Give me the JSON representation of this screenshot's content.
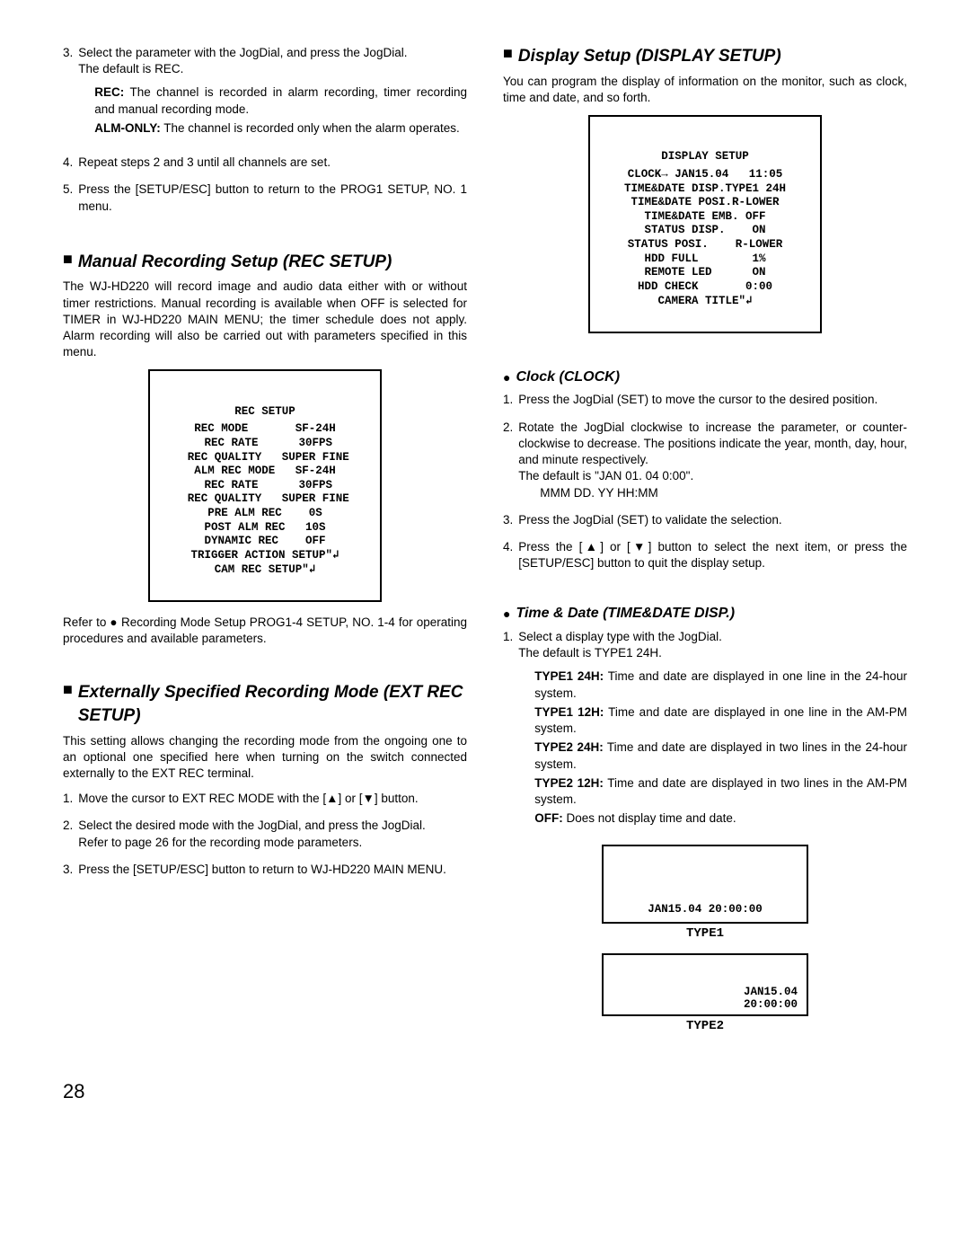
{
  "left": {
    "step3": {
      "num": "3.",
      "text": "Select the parameter with the JogDial, and press the JogDial.",
      "sub": "The default is REC.",
      "def_rec_label": "REC:",
      "def_rec_text": " The channel is recorded in alarm recording, timer recording and manual recording mode.",
      "def_alm_label": "ALM-ONLY:",
      "def_alm_text": " The channel is recorded only when the alarm operates."
    },
    "step4": {
      "num": "4.",
      "text": "Repeat steps 2 and 3 until all channels are set."
    },
    "step5": {
      "num": "5.",
      "text": "Press the [SETUP/ESC] button to return to the PROG1 SETUP, NO. 1 menu."
    },
    "rec_heading": "Manual Recording Setup (REC SETUP)",
    "rec_para": "The WJ-HD220 will record image and audio data either with or without timer restrictions. Manual recording is available when OFF is selected for TIMER in WJ-HD220 MAIN MENU; the timer schedule does not apply. Alarm recording will also be carried out with parameters specified in this menu.",
    "rec_screen_title": "REC SETUP",
    "rec_screen_body": "REC MODE       SF-24H\n REC RATE      30FPS\n REC QUALITY   SUPER FINE\nALM REC MODE   SF-24H\n REC RATE      30FPS\n REC QUALITY   SUPER FINE\nPRE ALM REC    0S\nPOST ALM REC   10S\nDYNAMIC REC    OFF\nTRIGGER ACTION SETUP\"↲\nCAM REC SETUP\"↲",
    "rec_ref": "Refer to ● Recording Mode Setup PROG1-4 SETUP, NO. 1-4 for operating procedures and available parameters.",
    "ext_heading": "Externally Specified Recording Mode (EXT REC SETUP)",
    "ext_para": "This setting allows changing the recording mode from the ongoing one to an optional one specified here when turning on the switch connected externally to the EXT REC terminal.",
    "ext1": {
      "num": "1.",
      "text": "Move the cursor to EXT REC MODE with the [▲] or [▼] button."
    },
    "ext2": {
      "num": "2.",
      "text": "Select the desired mode with the JogDial, and press the JogDial.",
      "sub": "Refer to page 26 for the recording mode parameters."
    },
    "ext3": {
      "num": "3.",
      "text": "Press the [SETUP/ESC] button to return to WJ-HD220 MAIN MENU."
    }
  },
  "right": {
    "disp_heading": "Display Setup (DISPLAY SETUP)",
    "disp_para": "You can program the display of information on the monitor, such as clock, time and date, and so forth.",
    "disp_screen_title": "DISPLAY SETUP",
    "disp_screen_body": "CLOCK→ JAN15.04   11:05\nTIME&DATE DISP.TYPE1 24H\nTIME&DATE POSI.R-LOWER\nTIME&DATE EMB. OFF\nSTATUS DISP.    ON\nSTATUS POSI.    R-LOWER\nHDD FULL        1%\nREMOTE LED      ON\nHDD CHECK       0:00\nCAMERA TITLE\"↲",
    "clock_heading": "Clock (CLOCK)",
    "c1": {
      "num": "1.",
      "text": "Press the JogDial (SET) to move the cursor to the desired position."
    },
    "c2": {
      "num": "2.",
      "text": "Rotate the JogDial clockwise to increase the parameter, or counter-clockwise to decrease. The positions indicate the year, month, day, hour, and minute respectively.",
      "sub1": "The default is \"JAN 01. 04 0:00\".",
      "sub2": "MMM DD. YY HH:MM"
    },
    "c3": {
      "num": "3.",
      "text": "Press the JogDial (SET) to validate the selection."
    },
    "c4": {
      "num": "4.",
      "text": "Press the [▲] or [▼] button to select the next item, or press the [SETUP/ESC] button to quit the display setup."
    },
    "td_heading": "Time & Date (TIME&DATE DISP.)",
    "td1": {
      "num": "1.",
      "text": "Select a display type with the JogDial.",
      "sub": "The default is TYPE1 24H."
    },
    "td_defs": {
      "t1_24_l": "TYPE1 24H:",
      "t1_24_t": " Time and date are displayed in one line in the 24-hour system.",
      "t1_12_l": "TYPE1 12H:",
      "t1_12_t": " Time and date are displayed in one line in the AM-PM system.",
      "t2_24_l": "TYPE2 24H:",
      "t2_24_t": " Time and date are displayed in two lines in the 24-hour system.",
      "t2_12_l": "TYPE2 12H:",
      "t2_12_t": " Time and date are displayed in two lines in the AM-PM system.",
      "off_l": "OFF:",
      "off_t": " Does not display time and date."
    },
    "type1_text": "JAN15.04  20:00:00",
    "type1_label": "TYPE1",
    "type2_line1": "JAN15.04",
    "type2_line2": "20:00:00",
    "type2_label": "TYPE2"
  },
  "page_number": "28"
}
